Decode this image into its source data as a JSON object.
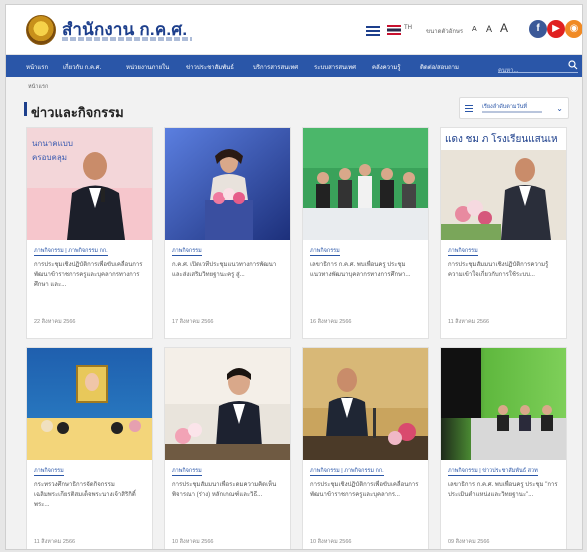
{
  "header": {
    "site_title": "สำนักงาน ก.ค.ศ.",
    "language": "TH",
    "font_size_label": "ขนาดตัวอักษร",
    "font_sizes": [
      "A",
      "A",
      "A"
    ]
  },
  "nav": {
    "items": [
      "หน้าแรก",
      "เกี่ยวกับ ก.ค.ศ.",
      "หน่วยงานภายใน",
      "ข่าวประชาสัมพันธ์",
      "บริการสารสนเทศ",
      "ระบบสารสนเทศ",
      "คลังความรู้",
      "ติดต่อ/สอบถาม"
    ],
    "search_placeholder": "ค้นหา..."
  },
  "breadcrumb": "หน้าแรก",
  "section": {
    "title": "ข่าวและกิจกรรม",
    "filter_label": "เรียงลำดับตามวันที่"
  },
  "cards": [
    {
      "tag": "ภาพกิจกรรม | ภาพกิจกรรม กก.",
      "title": "การประชุมเชิงปฏิบัติการเพื่อขับเคลื่อนการพัฒนาข้าราชการครูและบุคลากรทางการศึกษา และ...",
      "date": "22 สิงหาคม 2566"
    },
    {
      "tag": "ภาพกิจกรรม",
      "title": "ก.ค.ศ. เปิดเวทีประชุมแนวทางการพัฒนาและส่งเสริมวิทยฐานะครู สู่...",
      "date": "17 สิงหาคม 2566"
    },
    {
      "tag": "ภาพกิจกรรม",
      "title": "เลขาธิการ ก.ค.ศ. พบเพื่อนครู ประชุมแนวทางพัฒนาบุคลากรทางการศึกษา...",
      "date": "16 สิงหาคม 2566"
    },
    {
      "tag": "ภาพกิจกรรม",
      "title": "การประชุมสัมมนาเชิงปฏิบัติการความรู้ความเข้าใจเกี่ยวกับการใช้ระบบ...",
      "date": "11 สิงหาคม 2566"
    },
    {
      "tag": "ภาพกิจกรรม",
      "title": "กระทรวงศึกษาธิการจัดกิจกรรมเฉลิมพระเกียรติสมเด็จพระนางเจ้าสิริกิติ์ พระ...",
      "date": "11 สิงหาคม 2566"
    },
    {
      "tag": "ภาพกิจกรรม",
      "title": "การประชุมสัมมนาเพื่อระดมความคิดเห็นพิจารณา (ร่าง) หลักเกณฑ์และวิธี...",
      "date": "10 สิงหาคม 2566"
    },
    {
      "tag": "ภาพกิจกรรม | ภาพกิจกรรม กก.",
      "title": "การประชุมเชิงปฏิบัติการเพื่อขับเคลื่อนการพัฒนาข้าราชการครูและบุคลากร...",
      "date": "10 สิงหาคม 2566"
    },
    {
      "tag": "ภาพกิจกรรม | ข่าวประชาสัมพันธ์ สวท",
      "title": "เลขาธิการ ก.ค.ศ. พบเพื่อนครู ประชุม \"การประเมินตำแหน่งและวิทยฐานะ\"...",
      "date": "09 สิงหาคม 2566"
    }
  ],
  "colors": {
    "brand": "#1d3f8c",
    "nav": "#2a56a8"
  }
}
